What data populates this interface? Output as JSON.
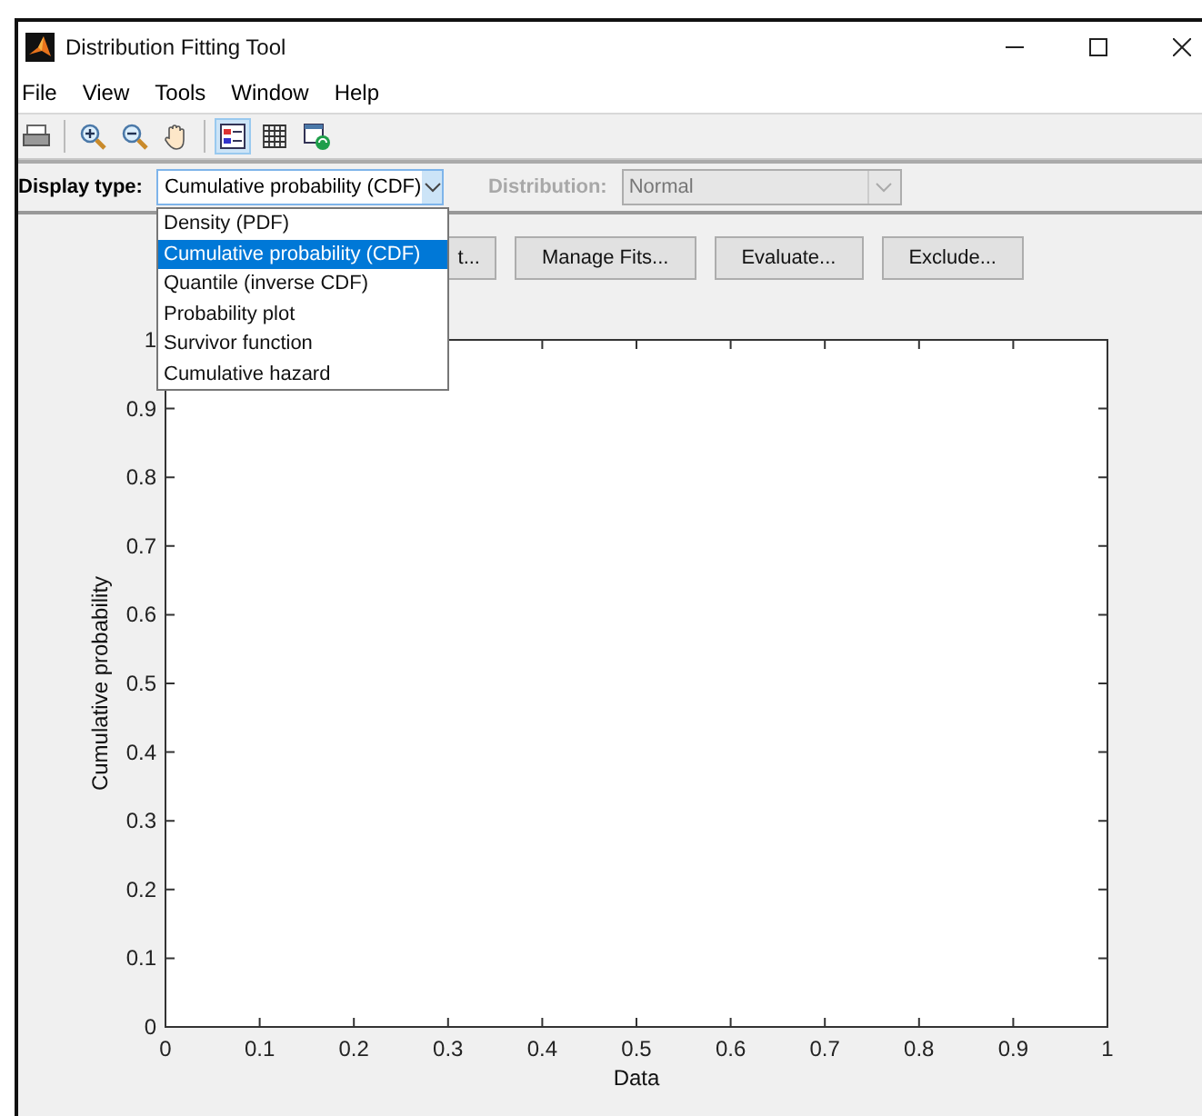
{
  "window": {
    "title": "Distribution Fitting Tool"
  },
  "menu": [
    "File",
    "View",
    "Tools",
    "Window",
    "Help"
  ],
  "toolbar": [
    {
      "kind": "print",
      "on": false
    },
    {
      "kind": "zoom-in",
      "on": false
    },
    {
      "kind": "zoom-out",
      "on": false
    },
    {
      "kind": "pan",
      "on": false
    },
    {
      "kind": "legend",
      "on": true
    },
    {
      "kind": "grid",
      "on": false
    },
    {
      "kind": "window",
      "on": false
    }
  ],
  "display_type": {
    "label": "Display type:",
    "value": "Cumulative probability (CDF)",
    "expanded": true,
    "options": [
      {
        "label": "Density (PDF)",
        "selected": false
      },
      {
        "label": "Cumulative probability (CDF)",
        "selected": true
      },
      {
        "label": "Quantile (inverse CDF)",
        "selected": false
      },
      {
        "label": "Probability plot",
        "selected": false
      },
      {
        "label": "Survivor function",
        "selected": false
      },
      {
        "label": "Cumulative hazard",
        "selected": false
      }
    ]
  },
  "distribution": {
    "label": "Distribution:",
    "value": "Normal",
    "disabled": true
  },
  "buttons": [
    "t...",
    "Manage Fits...",
    "Evaluate...",
    "Exclude..."
  ],
  "plot": {
    "chart_data": {
      "type": "line",
      "xlabel": "Data",
      "ylabel": "Cumulative probability",
      "xlim": [
        0,
        1
      ],
      "ylim": [
        0,
        1
      ],
      "xticks": [
        0,
        0.1,
        0.2,
        0.3,
        0.4,
        0.5,
        0.6,
        0.7,
        0.8,
        0.9,
        1
      ],
      "yticks": [
        0,
        0.1,
        0.2,
        0.3,
        0.4,
        0.5,
        0.6,
        0.7,
        0.8,
        0.9,
        1
      ]
    }
  }
}
